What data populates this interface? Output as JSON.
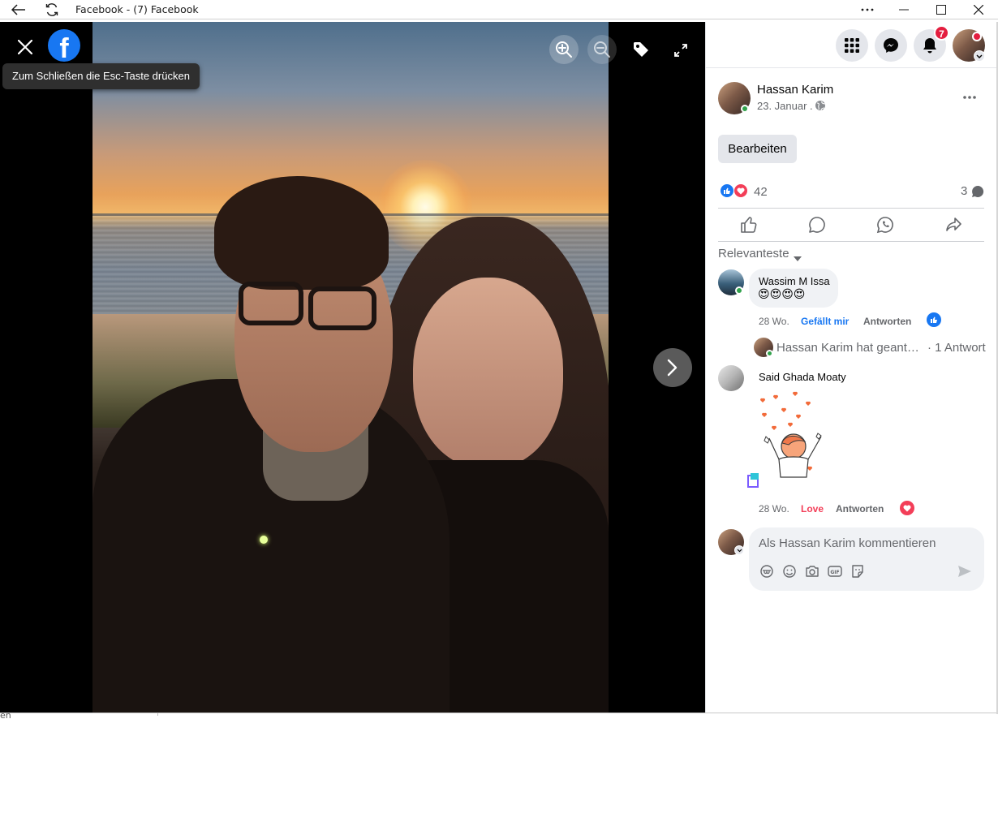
{
  "window": {
    "title": "Facebook - (7) Facebook",
    "controls": [
      "more-icon",
      "minimize-icon",
      "maximize-icon",
      "close-icon"
    ]
  },
  "viewer": {
    "tooltip": "Zum Schließen die Esc-Taste drücken",
    "logo_letter": "f",
    "photo_alt": "Selfie of Hassan Karim and a woman at the beach during sunset",
    "icons": [
      "close-icon",
      "facebook-logo",
      "zoom-in-icon",
      "zoom-out-icon",
      "tag-icon",
      "fullscreen-icon",
      "next-arrow-icon"
    ]
  },
  "topnav": {
    "notification_count": "7",
    "buttons": [
      "apps-menu-icon",
      "messenger-icon",
      "notifications-icon",
      "account-avatar"
    ]
  },
  "post": {
    "author": "Hassan Karim",
    "date": "23. Januar .",
    "privacy_icon": "globe-icon",
    "options_icon": "more-options-icon",
    "edit_label": "Bearbeiten",
    "reaction_count": "42",
    "comment_count": "3",
    "reactions": [
      "like-reaction",
      "love-reaction"
    ],
    "actions": [
      "like-icon",
      "comment-icon",
      "whatsapp-icon",
      "share-icon"
    ]
  },
  "comments": {
    "sort_label": "Relevanteste",
    "items": [
      {
        "author": "Wassim M Issa",
        "text": "😍😍😍😍",
        "time": "28 Wo.",
        "like_label": "Gefällt mir",
        "reply_label": "Antworten",
        "reaction": "like-reaction"
      },
      {
        "author": "Said Ghada Moaty",
        "sticker": "hearts-sticker",
        "time": "28 Wo.",
        "like_label": "Love",
        "reply_label": "Antworten",
        "reaction": "love-reaction"
      }
    ],
    "reply_summary": "Hassan Karim hat geant…",
    "reply_count": "· 1 Antwort"
  },
  "composer": {
    "placeholder": "Als Hassan Karim kommentieren",
    "icons": [
      "avatar-sticker-icon",
      "emoji-icon",
      "camera-icon",
      "gif-icon",
      "sticker-icon",
      "send-icon"
    ]
  },
  "colors": {
    "brand": "#1877f2",
    "notification": "#e41e3f",
    "love": "#f33e58",
    "online": "#31a24c"
  },
  "background_text": "en"
}
